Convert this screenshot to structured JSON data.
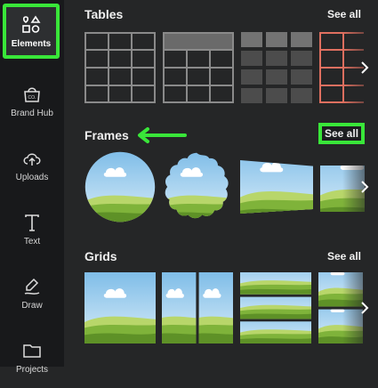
{
  "sidebar": {
    "items": [
      {
        "label": "Elements",
        "icon": "elements-icon",
        "active": true
      },
      {
        "label": "Brand Hub",
        "icon": "brand-hub-icon"
      },
      {
        "label": "Uploads",
        "icon": "upload-cloud-icon"
      },
      {
        "label": "Text",
        "icon": "text-icon"
      },
      {
        "label": "Draw",
        "icon": "draw-icon"
      },
      {
        "label": "Projects",
        "icon": "folder-icon"
      }
    ]
  },
  "sections": {
    "tables": {
      "title": "Tables",
      "see_all": "See all"
    },
    "frames": {
      "title": "Frames",
      "see_all": "See all"
    },
    "grids": {
      "title": "Grids",
      "see_all": "See all"
    }
  },
  "brand_icon_text": "CO.",
  "colors": {
    "highlight": "#39e639",
    "sidebar": "#18191b",
    "panel": "#252627",
    "accent_table": "#e07060"
  }
}
